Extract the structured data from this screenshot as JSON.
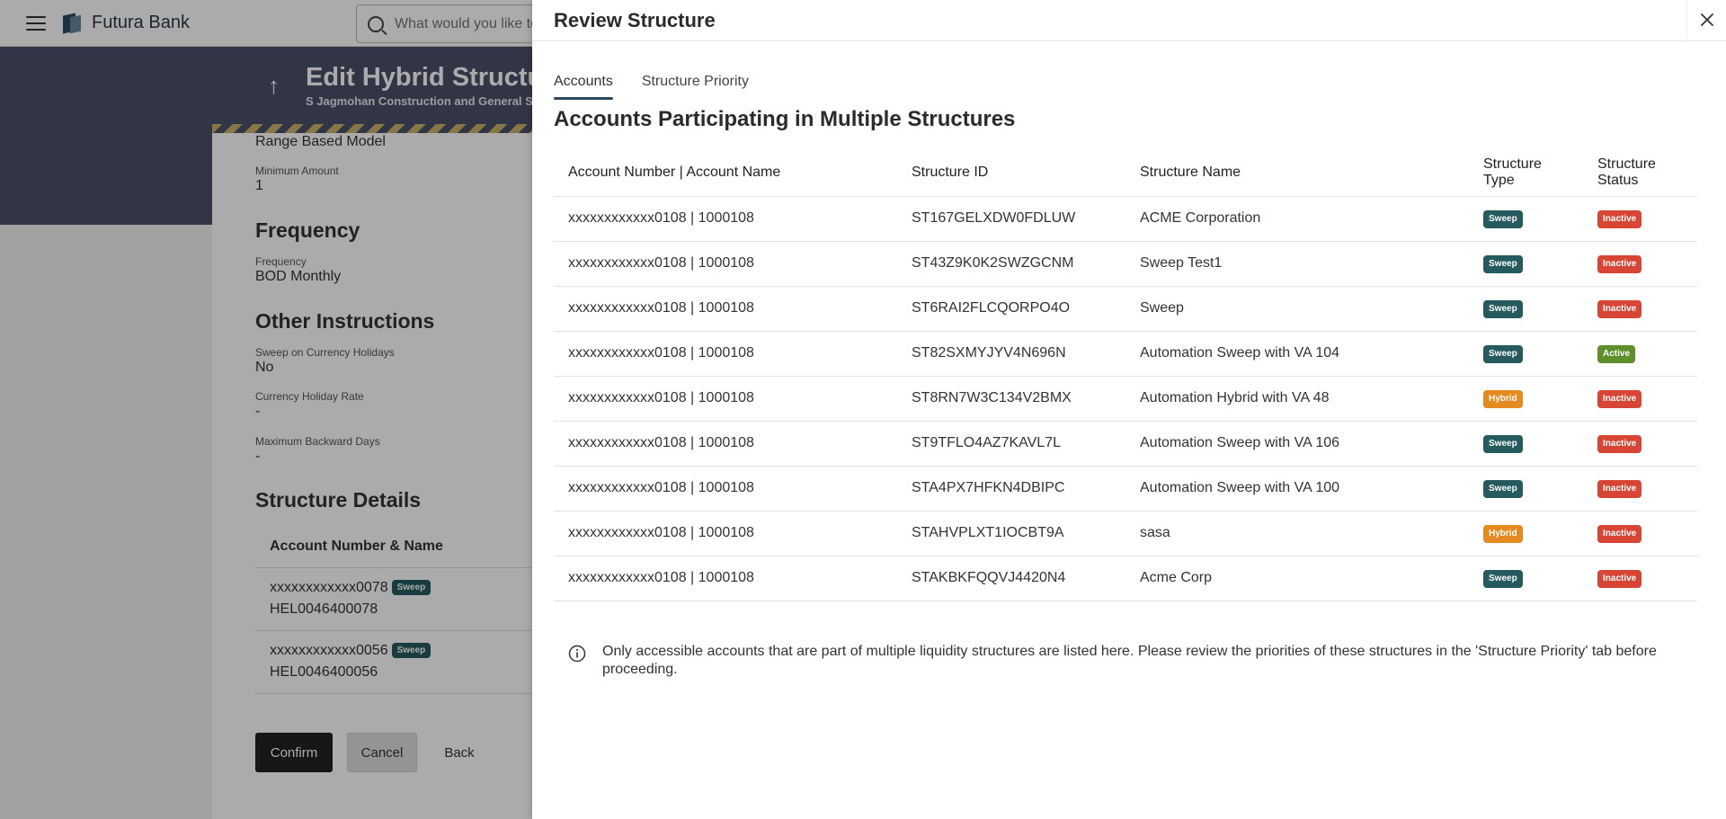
{
  "app": {
    "brand": "Futura Bank",
    "search_placeholder": "What would you like to do today?"
  },
  "background": {
    "title": "Edit Hybrid Structure",
    "subtitle": "S Jagmohan Construction and General Supplies",
    "range_model": "Range Based Model",
    "min_amount_label": "Minimum Amount",
    "min_amount_value": "1",
    "frequency_heading": "Frequency",
    "frequency_label": "Frequency",
    "frequency_value": "BOD Monthly",
    "other_heading": "Other Instructions",
    "sweep_holiday_label": "Sweep on Currency Holidays",
    "sweep_holiday_value": "No",
    "holiday_rate_label": "Currency Holiday Rate",
    "holiday_rate_value": "-",
    "backward_days_label": "Maximum Backward Days",
    "backward_days_value": "-",
    "structure_details_heading": "Structure Details",
    "acct_col_header": "Account Number & Name",
    "rows": [
      {
        "number": "xxxxxxxxxxxx0078",
        "badge": "Sweep",
        "name": "HEL0046400078"
      },
      {
        "number": "xxxxxxxxxxxx0056",
        "badge": "Sweep",
        "name": "HEL0046400056"
      }
    ],
    "buttons": {
      "confirm": "Confirm",
      "cancel": "Cancel",
      "back": "Back"
    }
  },
  "drawer": {
    "title": "Review Structure",
    "tabs": [
      {
        "label": "Accounts",
        "active": true
      },
      {
        "label": "Structure Priority",
        "active": false
      }
    ],
    "section_title": "Accounts Participating in Multiple Structures",
    "columns": [
      "Account Number | Account Name",
      "Structure ID",
      "Structure Name",
      "Structure Type",
      "Structure Status"
    ],
    "rows": [
      {
        "account": "xxxxxxxxxxxx0108 | 1000108",
        "id": "ST167GELXDW0FDLUW",
        "name": "ACME Corporation",
        "type": "Sweep",
        "status": "Inactive"
      },
      {
        "account": "xxxxxxxxxxxx0108 | 1000108",
        "id": "ST43Z9K0K2SWZGCNM",
        "name": "Sweep Test1",
        "type": "Sweep",
        "status": "Inactive"
      },
      {
        "account": "xxxxxxxxxxxx0108 | 1000108",
        "id": "ST6RAI2FLCQORPO4O",
        "name": "Sweep",
        "type": "Sweep",
        "status": "Inactive"
      },
      {
        "account": "xxxxxxxxxxxx0108 | 1000108",
        "id": "ST82SXMYJYV4N696N",
        "name": "Automation Sweep with VA 104",
        "type": "Sweep",
        "status": "Active"
      },
      {
        "account": "xxxxxxxxxxxx0108 | 1000108",
        "id": "ST8RN7W3C134V2BMX",
        "name": "Automation Hybrid with VA 48",
        "type": "Hybrid",
        "status": "Inactive"
      },
      {
        "account": "xxxxxxxxxxxx0108 | 1000108",
        "id": "ST9TFLO4AZ7KAVL7L",
        "name": "Automation Sweep with VA 106",
        "type": "Sweep",
        "status": "Inactive"
      },
      {
        "account": "xxxxxxxxxxxx0108 | 1000108",
        "id": "STA4PX7HFKN4DBIPC",
        "name": "Automation Sweep with VA 100",
        "type": "Sweep",
        "status": "Inactive"
      },
      {
        "account": "xxxxxxxxxxxx0108 | 1000108",
        "id": "STAHVPLXT1IOCBT9A",
        "name": "sasa",
        "type": "Hybrid",
        "status": "Inactive"
      },
      {
        "account": "xxxxxxxxxxxx0108 | 1000108",
        "id": "STAKBKFQQVJ4420N4",
        "name": "Acme Corp",
        "type": "Sweep",
        "status": "Inactive"
      }
    ],
    "note": "Only accessible accounts that are part of multiple liquidity structures are listed here. Please review the priorities of these structures in the 'Structure Priority' tab before proceeding."
  },
  "icons": {
    "menu": "hamburger-menu-icon",
    "search": "search-icon",
    "back": "arrow-up-icon",
    "close": "close-icon",
    "info": "info-icon"
  },
  "colors": {
    "hero": "#4b5068",
    "sweep_badge": "#255a5e",
    "hybrid_badge": "#e58a1f",
    "inactive_badge": "#d94535",
    "active_badge": "#5f8f2a",
    "tab_indicator": "#2f4a5e"
  }
}
